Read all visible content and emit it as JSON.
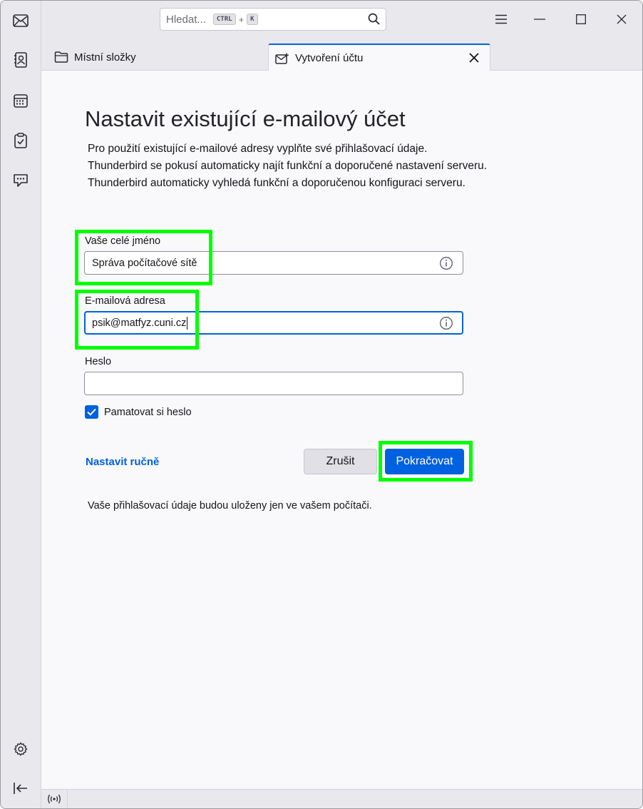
{
  "search": {
    "placeholder": "Hledat...",
    "shortcut_mod": "CTRL",
    "shortcut_plus": "+",
    "shortcut_key": "K"
  },
  "tabs": [
    {
      "label": "Místní složky",
      "icon": "folder-icon"
    },
    {
      "label": "Vytvoření účtu",
      "icon": "mail-new-icon"
    }
  ],
  "spaces": [
    "mail-icon",
    "address-book-icon",
    "calendar-icon",
    "tasks-icon",
    "chat-icon",
    "settings-icon",
    "collapse-sidebar-icon"
  ],
  "form": {
    "heading": "Nastavit existující e-mailový účet",
    "desc_line1": "Pro použití existující e-mailové adresy vyplňte své přihlašovací údaje.",
    "desc_line2": "Thunderbird se pokusí automaticky najít funkční a doporučené nastavení serveru.",
    "desc_line3": "Thunderbird automaticky vyhledá funkční a doporučenou konfiguraci serveru.",
    "name_label": "Vaše celé jméno",
    "name_value": "Správa počítačové sítě",
    "email_label": "E-mailová adresa",
    "email_value": "psik@matfyz.cuni.cz",
    "password_label": "Heslo",
    "password_value": "",
    "remember_label": "Pamatovat si heslo",
    "remember_checked": true,
    "manual_link": "Nastavit ručně",
    "cancel_label": "Zrušit",
    "continue_label": "Pokračovat",
    "footnote": "Vaše přihlašovací údaje budou uloženy jen ve vašem počítači."
  },
  "colors": {
    "accent": "#0061e0",
    "highlight": "#00ff00"
  }
}
